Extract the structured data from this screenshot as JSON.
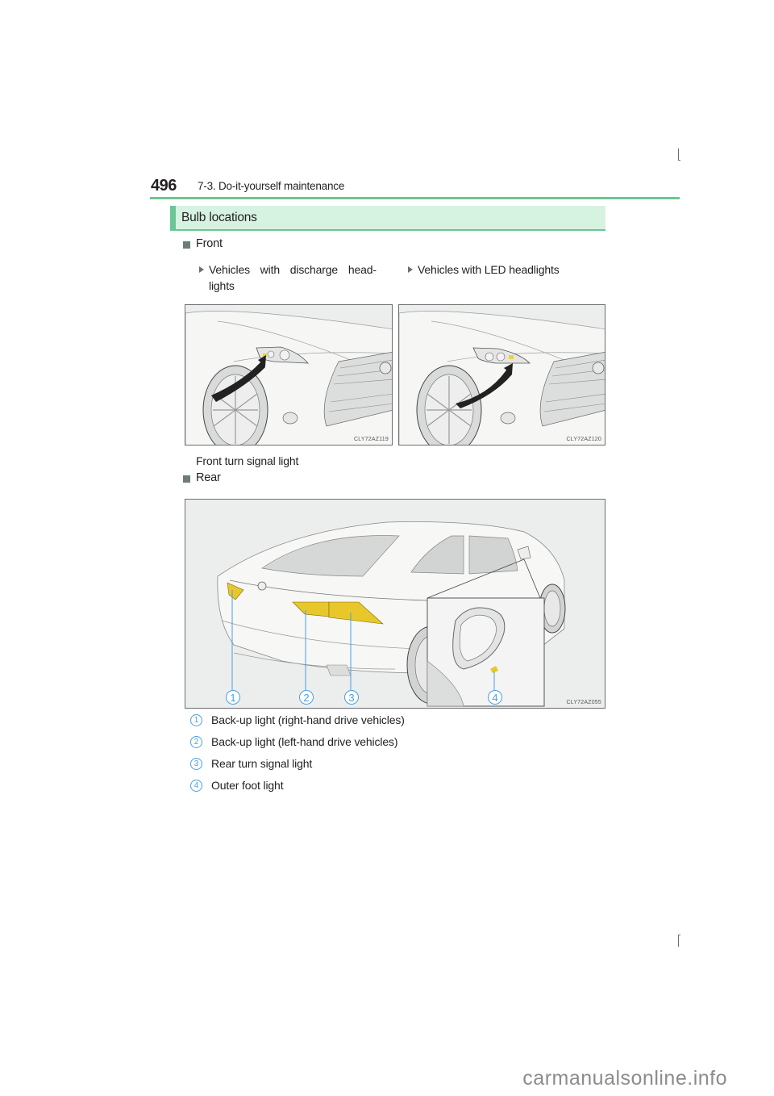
{
  "header": {
    "page_number": "496",
    "section": "7-3. Do-it-yourself maintenance"
  },
  "heading": {
    "title": "Bulb locations"
  },
  "front": {
    "label": "Front",
    "variants": [
      {
        "label_line1": "Vehicles with discharge head-",
        "label_line2": "lights",
        "figure_code": "CLY72AZ119"
      },
      {
        "label_line1": "Vehicles with LED headlights",
        "figure_code": "CLY72AZ120"
      }
    ],
    "caption": "Front turn signal light"
  },
  "rear": {
    "label": "Rear",
    "figure_code": "CLY72AZ055",
    "callouts": [
      "1",
      "2",
      "3",
      "4"
    ],
    "legend": [
      {
        "num": "1",
        "text": "Back-up light (right-hand drive vehicles)"
      },
      {
        "num": "2",
        "text": "Back-up light (left-hand drive vehicles)"
      },
      {
        "num": "3",
        "text": "Rear turn signal light"
      },
      {
        "num": "4",
        "text": "Outer foot light"
      }
    ]
  },
  "colors": {
    "accent_green": "#6cc594",
    "heading_bg": "#d6f3e1",
    "callout_blue": "#4a9fe0",
    "bulb_yellow": "#e8c72a"
  },
  "watermark": "carmanualsonline.info"
}
